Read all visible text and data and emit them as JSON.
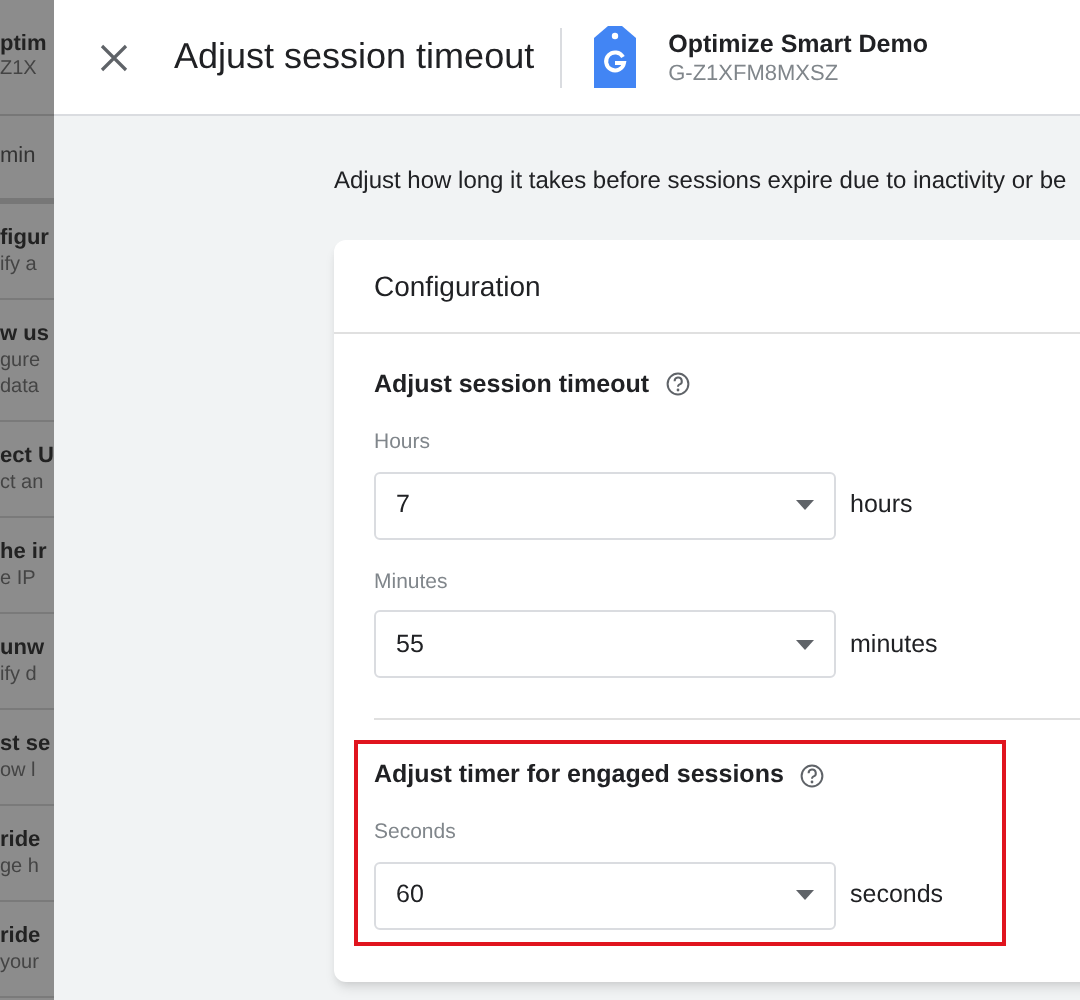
{
  "sidebar": {
    "header": {
      "title": "ptim",
      "subtitle": "Z1X"
    },
    "section": "min",
    "items": [
      {
        "title": "figur",
        "lines": [
          "ify a"
        ]
      },
      {
        "title": "w us",
        "lines": [
          "gure",
          "data"
        ]
      },
      {
        "title": "ect U",
        "lines": [
          "ct an"
        ]
      },
      {
        "title": "he ir",
        "lines": [
          "e IP"
        ]
      },
      {
        "title": "unw",
        "lines": [
          "ify d"
        ]
      },
      {
        "title": "st se",
        "lines": [
          "ow l"
        ]
      },
      {
        "title": "ride",
        "lines": [
          "ge h"
        ]
      },
      {
        "title": "ride",
        "lines": [
          "your"
        ]
      }
    ]
  },
  "dialog": {
    "title": "Adjust session timeout",
    "property": {
      "name": "Optimize Smart Demo",
      "id": "G-Z1XFM8MXSZ"
    },
    "description": "Adjust how long it takes before sessions expire due to inactivity or be",
    "card": {
      "title": "Configuration",
      "sections": [
        {
          "heading": "Adjust session timeout",
          "highlighted": false,
          "fields": [
            {
              "label": "Hours",
              "value": "7",
              "unit": "hours"
            },
            {
              "label": "Minutes",
              "value": "55",
              "unit": "minutes"
            }
          ]
        },
        {
          "heading": "Adjust timer for engaged sessions",
          "highlighted": true,
          "fields": [
            {
              "label": "Seconds",
              "value": "60",
              "unit": "seconds"
            }
          ]
        }
      ]
    }
  }
}
